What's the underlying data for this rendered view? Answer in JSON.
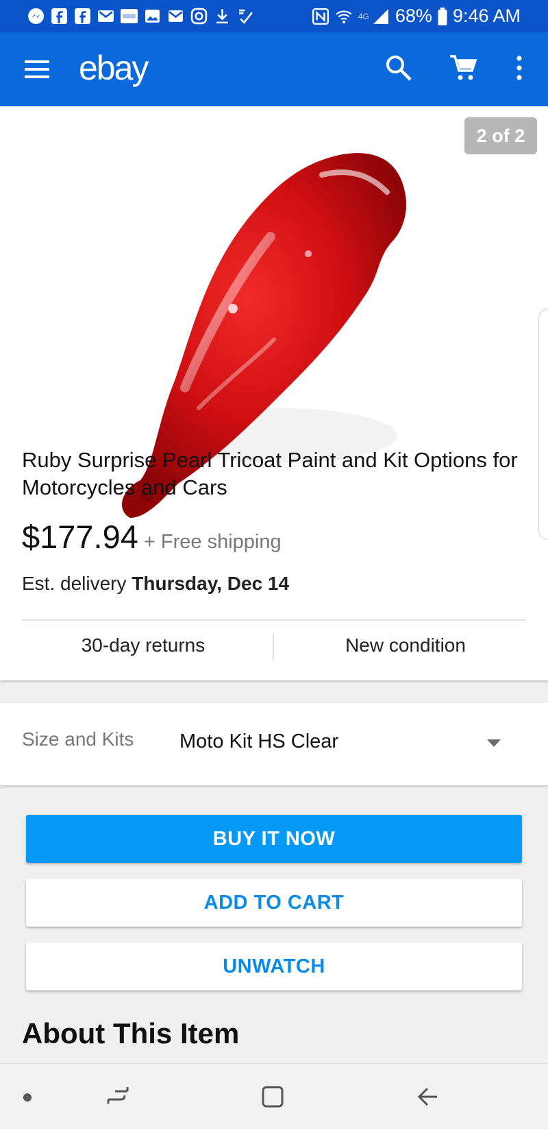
{
  "status_bar": {
    "battery": "68%",
    "time": "9:46 AM",
    "network": "4G",
    "left_icons": [
      "messenger-icon",
      "facebook-icon",
      "facebook-icon",
      "gmail-icon",
      "ebay-app-icon",
      "gallery-icon",
      "email-icon",
      "instagram-icon",
      "download-icon",
      "check-icon"
    ]
  },
  "app_bar": {
    "logo": "ebay",
    "color": "#0a69dc"
  },
  "listing": {
    "image_counter": "2 of 2",
    "title": "Ruby Surprise Pearl Tricoat Paint and Kit Options for Motorcycles and Cars",
    "price": "$177.94",
    "shipping": "+ Free shipping",
    "delivery_prefix": "Est. delivery",
    "delivery_date": "Thursday, Dec 14",
    "returns": "30-day returns",
    "condition": "New condition"
  },
  "variation": {
    "label": "Size and Kits",
    "selected": "Moto Kit HS Clear"
  },
  "actions": {
    "buy_now": "BUY IT NOW",
    "add_to_cart": "ADD TO CART",
    "unwatch": "UNWATCH",
    "accent": "#0699f7"
  },
  "section": {
    "about": "About This Item"
  }
}
